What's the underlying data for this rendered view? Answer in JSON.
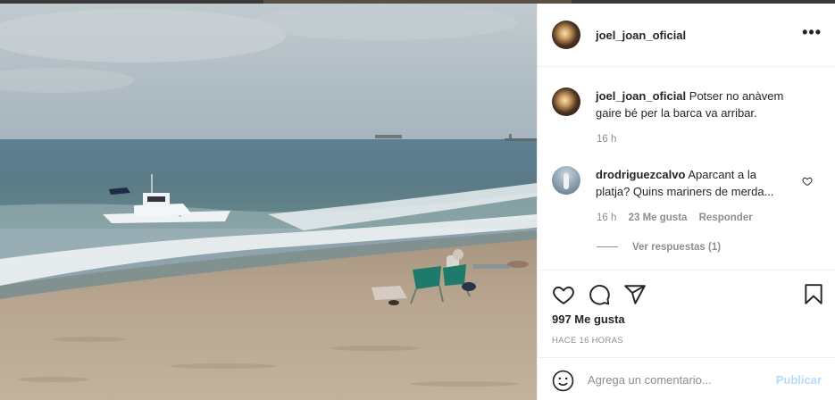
{
  "post": {
    "username": "joel_joan_oficial",
    "caption_text": "Potser no anàvem gaire bé per la barca va arribar.",
    "caption_time": "16 h",
    "comments": [
      {
        "username": "drodriguezcalvo",
        "text": "Aparcant a la platja? Quins mariners de merda...",
        "time": "16 h",
        "likes": "23 Me gusta",
        "reply_label": "Responder",
        "view_replies": "Ver respuestas (1)"
      }
    ],
    "likes_count": "997 Me gusta",
    "timestamp": "HACE 16 HORAS",
    "comment_placeholder": "Agrega un comentario...",
    "publish_label": "Publicar"
  },
  "icons": {
    "options": "more-options-icon",
    "like": "heart-icon",
    "comment": "comment-icon",
    "share": "paper-plane-icon",
    "save": "bookmark-icon",
    "emoji": "emoji-icon"
  },
  "colors": {
    "text": "#262626",
    "muted": "#8e8e8e",
    "border": "#efefef",
    "publish_disabled": "#b3dbff"
  }
}
